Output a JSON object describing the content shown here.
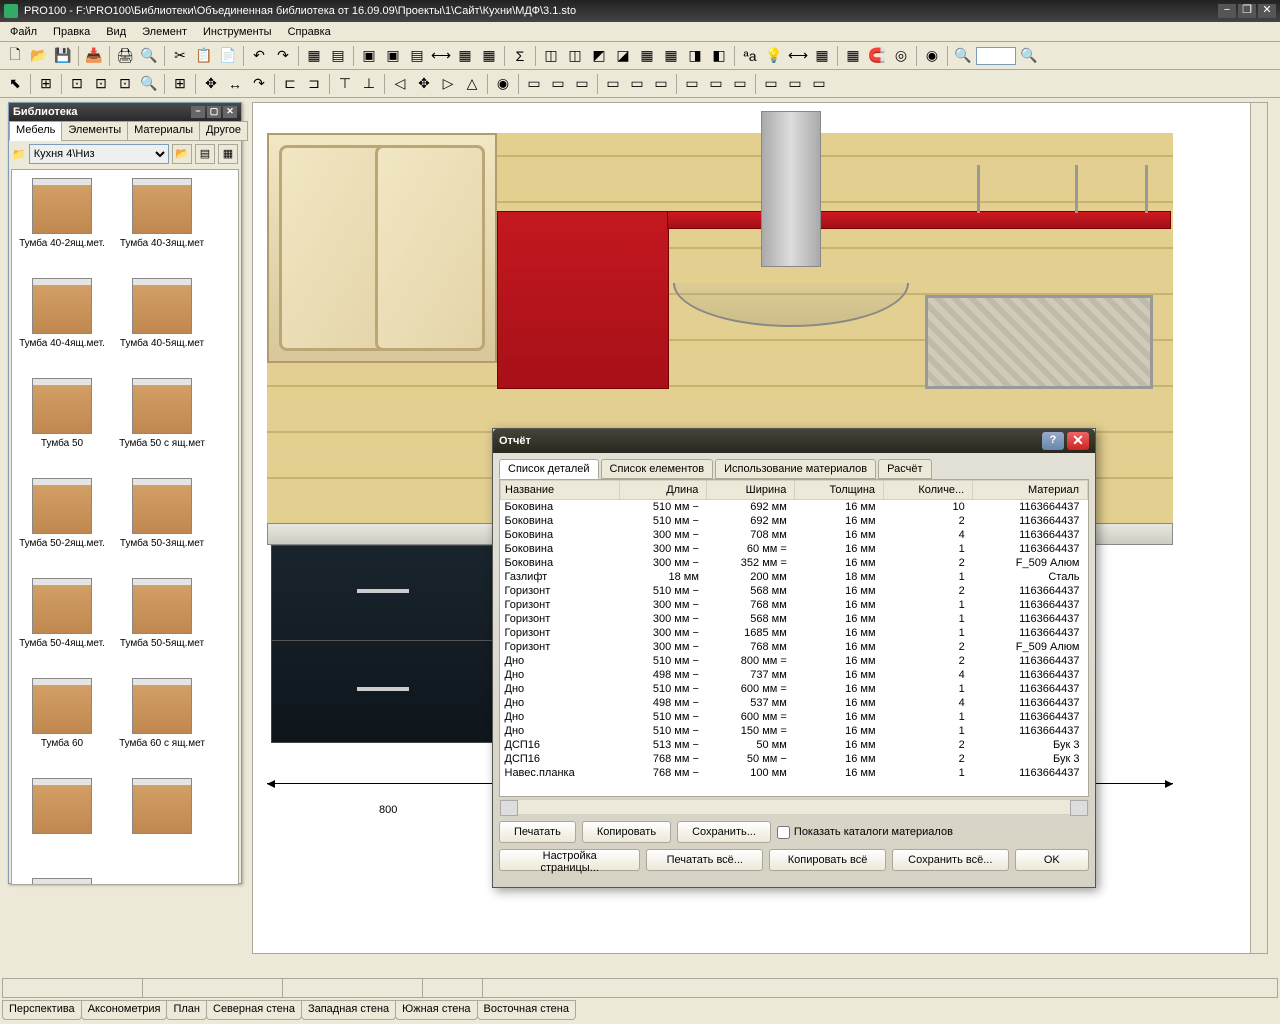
{
  "title": "PRO100 - F:\\PRO100\\Библиотеки\\Объединенная библиотека от 16.09.09\\Проекты\\1\\Сайт\\Кухни\\МДФ\\3.1.sto",
  "menu": [
    "Файл",
    "Правка",
    "Вид",
    "Элемент",
    "Инструменты",
    "Справка"
  ],
  "lib": {
    "title": "Библиотека",
    "tabs": [
      "Мебель",
      "Элементы",
      "Материалы",
      "Другое"
    ],
    "path": "Кухня 4\\Низ",
    "items": [
      "Тумба 40-2ящ.мет.",
      "Тумба 40-3ящ.мет",
      "Тумба 40-4ящ.мет.",
      "Тумба 40-5ящ.мет",
      "Тумба 50",
      "Тумба 50 с ящ.мет",
      "Тумба 50-2ящ.мет.",
      "Тумба 50-3ящ.мет",
      "Тумба 50-4ящ.мет.",
      "Тумба 50-5ящ.мет",
      "Тумба 60",
      "Тумба 60 с ящ.мет",
      "",
      "",
      ""
    ]
  },
  "canvas": {
    "dim": "800"
  },
  "report": {
    "title": "Отчёт",
    "tabs": [
      "Список деталей",
      "Список елементов",
      "Использование материалов",
      "Расчёт"
    ],
    "cols": [
      "Название",
      "Длина",
      "Ширина",
      "Толщина",
      "Количе...",
      "Материал"
    ],
    "rows": [
      [
        "Боковина",
        "510 мм −",
        "692 мм",
        "16 мм",
        "10",
        "1163664437"
      ],
      [
        "Боковина",
        "510 мм −",
        "692 мм",
        "16 мм",
        "2",
        "1163664437"
      ],
      [
        "Боковина",
        "300 мм −",
        "708 мм",
        "16 мм",
        "4",
        "1163664437"
      ],
      [
        "Боковина",
        "300 мм −",
        "60 мм =",
        "16 мм",
        "1",
        "1163664437"
      ],
      [
        "Боковина",
        "300 мм −",
        "352 мм =",
        "16 мм",
        "2",
        "F_509 Алюм"
      ],
      [
        "Газлифт",
        "18 мм",
        "200 мм",
        "18 мм",
        "1",
        "Сталь"
      ],
      [
        "Горизонт",
        "510 мм −",
        "568 мм",
        "16 мм",
        "2",
        "1163664437"
      ],
      [
        "Горизонт",
        "300 мм −",
        "768 мм",
        "16 мм",
        "1",
        "1163664437"
      ],
      [
        "Горизонт",
        "300 мм −",
        "568 мм",
        "16 мм",
        "1",
        "1163664437"
      ],
      [
        "Горизонт",
        "300 мм −",
        "1685 мм",
        "16 мм",
        "1",
        "1163664437"
      ],
      [
        "Горизонт",
        "300 мм −",
        "768 мм",
        "16 мм",
        "2",
        "F_509 Алюм"
      ],
      [
        "Дно",
        "510 мм −",
        "800 мм =",
        "16 мм",
        "2",
        "1163664437"
      ],
      [
        "Дно",
        "498 мм −",
        "737 мм",
        "16 мм",
        "4",
        "1163664437"
      ],
      [
        "Дно",
        "510 мм −",
        "600 мм =",
        "16 мм",
        "1",
        "1163664437"
      ],
      [
        "Дно",
        "498 мм −",
        "537 мм",
        "16 мм",
        "4",
        "1163664437"
      ],
      [
        "Дно",
        "510 мм −",
        "600 мм =",
        "16 мм",
        "1",
        "1163664437"
      ],
      [
        "Дно",
        "510 мм −",
        "150 мм =",
        "16 мм",
        "1",
        "1163664437"
      ],
      [
        "ДСП16",
        "513 мм −",
        "50 мм",
        "16 мм",
        "2",
        "Бук 3"
      ],
      [
        "ДСП16",
        "768 мм −",
        "50 мм −",
        "16 мм",
        "2",
        "Бук 3"
      ],
      [
        "Навес.планка",
        "768 мм −",
        "100 мм",
        "16 мм",
        "1",
        "1163664437"
      ]
    ],
    "btns": {
      "print": "Печатать",
      "copy": "Копировать",
      "save": "Сохранить...",
      "showcat": "Показать каталоги материалов",
      "pagesetup": "Настройка страницы...",
      "printall": "Печатать всё...",
      "copyall": "Копировать всё",
      "saveall": "Сохранить всё...",
      "ok": "OK"
    }
  },
  "btabs": [
    "Перспектива",
    "Аксонометрия",
    "План",
    "Северная стена",
    "Западная стена",
    "Южная стена",
    "Восточная стена"
  ]
}
